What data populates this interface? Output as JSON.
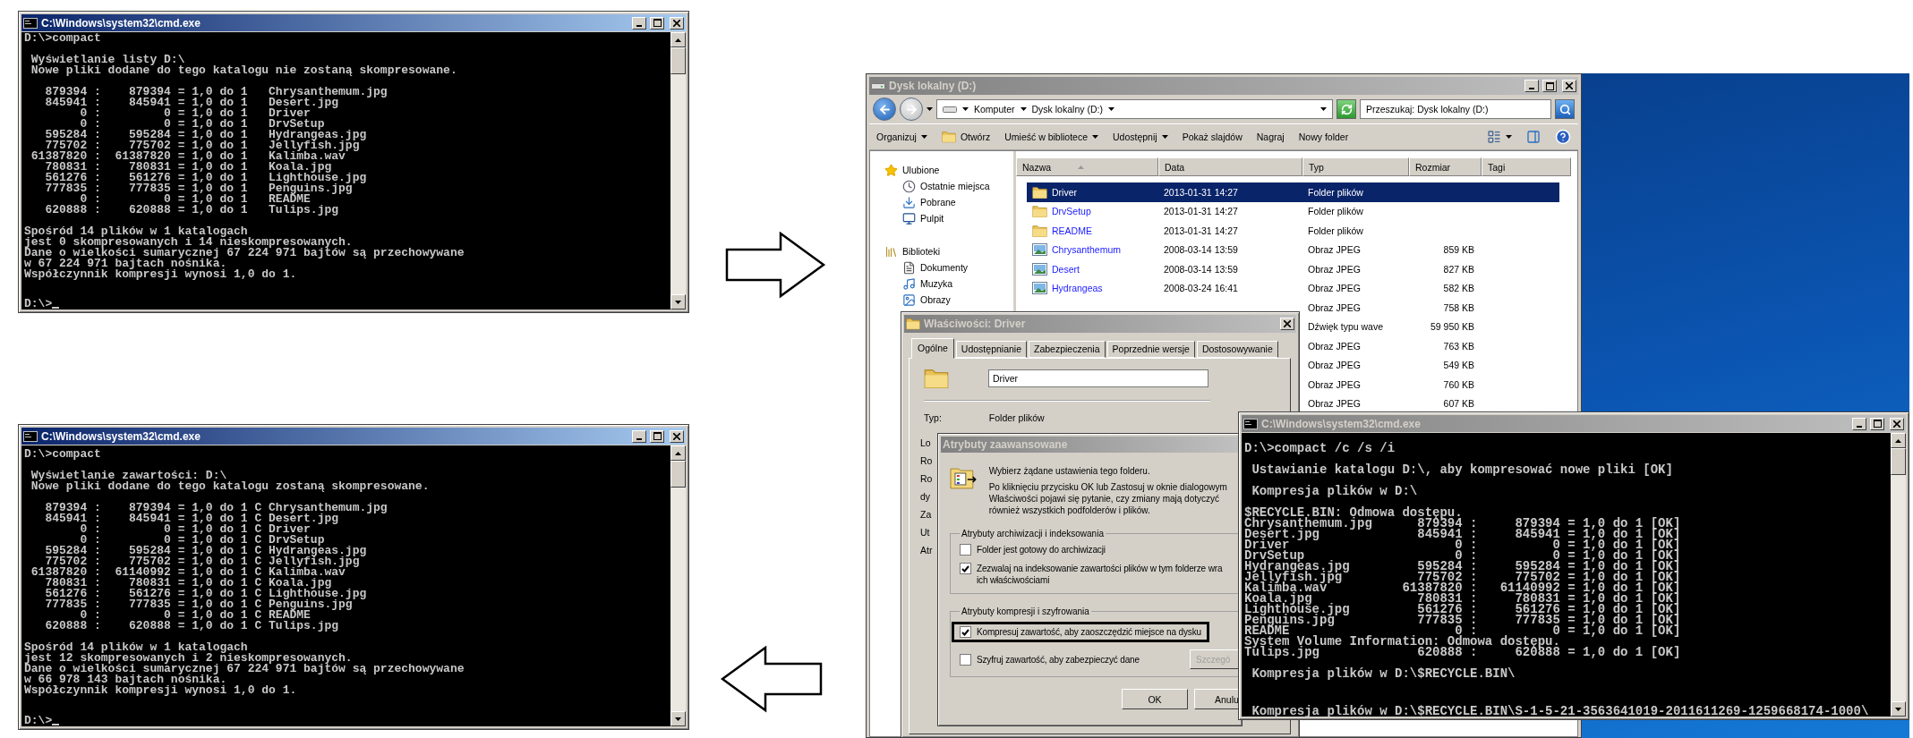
{
  "console_before": {
    "title": "C:\\Windows\\system32\\cmd.exe",
    "active": true,
    "blocks": [
      [
        "D:\\>compact"
      ],
      [
        " Wyświetlanie listy D:\\",
        " Nowe pliki dodane do tego katalogu nie zostaną skompresowane."
      ],
      [
        "   879394 :    879394 = 1,0 do 1   Chrysanthemum.jpg",
        "   845941 :    845941 = 1,0 do 1   Desert.jpg",
        "        0 :         0 = 1,0 do 1   Driver",
        "        0 :         0 = 1,0 do 1   DrvSetup",
        "   595284 :    595284 = 1,0 do 1   Hydrangeas.jpg",
        "   775702 :    775702 = 1,0 do 1   Jellyfish.jpg",
        " 61387820 :  61387820 = 1,0 do 1   Kalimba.wav",
        "   780831 :    780831 = 1,0 do 1   Koala.jpg",
        "   561276 :    561276 = 1,0 do 1   Lighthouse.jpg",
        "   777835 :    777835 = 1,0 do 1   Penguins.jpg",
        "        0 :         0 = 1,0 do 1   README",
        "   620888 :    620888 = 1,0 do 1   Tulips.jpg"
      ],
      [
        "Spośród 14 plików w 1 katalogach",
        "jest 0 skompresowanych i 14 nieskompresowanych.",
        "Dane o wielkości sumarycznej 67 224 971 bajtów są przechowywane",
        "w 67 224 971 bajtach nośnika.",
        "Współczynnik kompresji wynosi 1,0 do 1."
      ]
    ],
    "bottom_line": {
      "text": "D:\\>",
      "cursor": true
    }
  },
  "explorer": {
    "title": "Dysk lokalny (D:)",
    "active": false,
    "breadcrumb": [
      "Komputer",
      "Dysk lokalny (D:)"
    ],
    "search": {
      "placeholder": "Przeszukaj: Dysk lokalny (D:)"
    },
    "toolbar": [
      {
        "label": "Organizuj",
        "kind": "menu"
      },
      {
        "label": "Otwórz",
        "kind": "icon-command"
      },
      {
        "label": "Umieść w bibliotece",
        "kind": "menu"
      },
      {
        "label": "Udostępnij",
        "kind": "menu"
      },
      {
        "label": "Pokaż slajdów",
        "kind": "command"
      },
      {
        "label": "Nagraj",
        "kind": "command"
      },
      {
        "label": "Nowy folder",
        "kind": "command"
      }
    ],
    "nav": [
      {
        "label": "Ulubione",
        "kind": "star",
        "children": [
          {
            "label": "Ostatnie miejsca",
            "kind": "recent"
          },
          {
            "label": "Pobrane",
            "kind": "downloads"
          },
          {
            "label": "Pulpit",
            "kind": "desktop"
          }
        ]
      },
      {
        "label": "Biblioteki",
        "kind": "libraries",
        "children": [
          {
            "label": "Dokumenty",
            "kind": "documents"
          },
          {
            "label": "Muzyka",
            "kind": "music"
          },
          {
            "label": "Obrazy",
            "kind": "pictures"
          }
        ]
      }
    ],
    "columns": [
      {
        "label": "Nazwa",
        "sorted": true
      },
      {
        "label": "Data",
        "sorted": false
      },
      {
        "label": "Typ",
        "sorted": false
      },
      {
        "label": "Rozmiar",
        "sorted": false
      },
      {
        "label": "Tagi",
        "sorted": false
      }
    ],
    "files": [
      {
        "name": "Driver",
        "kind": "folder",
        "date": "2013-01-31 14:27",
        "type": "Folder plików",
        "selected": true
      },
      {
        "name": "DrvSetup",
        "kind": "folder",
        "date": "2013-01-31 14:27",
        "type": "Folder plików",
        "selected": false
      },
      {
        "name": "README",
        "kind": "folder",
        "date": "2013-01-31 14:27",
        "type": "Folder plików",
        "selected": false
      },
      {
        "name": "Chrysanthemum",
        "kind": "image",
        "date": "2008-03-14 13:59",
        "type": "Obraz JPEG",
        "size": "859 KB",
        "selected": false
      },
      {
        "name": "Desert",
        "kind": "image",
        "date": "2008-03-14 13:59",
        "type": "Obraz JPEG",
        "size": "827 KB",
        "selected": false
      },
      {
        "name": "Hydrangeas",
        "kind": "image",
        "date": "2008-03-24 16:41",
        "type": "Obraz JPEG",
        "size": "582 KB",
        "selected": false
      },
      {
        "type": "Obraz JPEG",
        "size": "758 KB",
        "selected": false
      },
      {
        "type": "Dźwięk typu wave",
        "size": "59 950 KB",
        "selected": false
      },
      {
        "type": "Obraz JPEG",
        "size": "763 KB",
        "selected": false
      },
      {
        "type": "Obraz JPEG",
        "size": "549 KB",
        "selected": false
      },
      {
        "type": "Obraz JPEG",
        "size": "760 KB",
        "selected": false
      },
      {
        "type": "Obraz JPEG",
        "size": "607 KB",
        "selected": false
      }
    ]
  },
  "properties_dialog": {
    "title": "Właściwości: Driver",
    "active": false,
    "tabs": [
      {
        "label": "Ogólne",
        "selected": true
      },
      {
        "label": "Udostępnianie",
        "selected": false
      },
      {
        "label": "Zabezpieczenia",
        "selected": false
      },
      {
        "label": "Poprzednie wersje",
        "selected": false
      },
      {
        "label": "Dostosowywanie",
        "selected": false
      }
    ],
    "name_field": {
      "value": "Driver"
    },
    "fields": [
      {
        "label": "Typ:",
        "value": "Folder plików"
      }
    ],
    "cut_labels": [
      "Lo",
      "Ro",
      "Ro",
      "dy",
      "Za",
      "Ut",
      "Atr"
    ]
  },
  "advanced_dialog": {
    "title": "Atrybuty zaawansowane",
    "active": false,
    "heading": "Wybierz żądane ustawienia tego folderu.",
    "description": "Po kliknięciu przycisku OK lub Zastosuj w oknie dialogowym Właściwości pojawi się pytanie, czy zmiany mają dotyczyć również wszystkich podfolderów i plików.",
    "groups": [
      {
        "legend": "Atrybuty archiwizacji i indeksowania",
        "options": [
          {
            "lines": [
              "Folder jest gotowy do archiwizacji"
            ],
            "checked": false,
            "highlighted": false
          },
          {
            "lines": [
              "Zezwalaj na indeksowanie zawartości plików w tym folderze wra",
              "ich właściwościami"
            ],
            "checked": true,
            "highlighted": false
          }
        ]
      },
      {
        "legend": "Atrybuty kompresji i szyfrowania",
        "options": [
          {
            "lines": [
              "Kompresuj zawartość, aby zaoszczędzić miejsce na dysku"
            ],
            "checked": true,
            "highlighted": true
          },
          {
            "lines": [
              "Szyfruj zawartość, aby zabezpieczyć dane"
            ],
            "checked": false,
            "highlighted": false
          }
        ],
        "button": {
          "label": "Szczegó",
          "disabled": true
        }
      }
    ],
    "buttons": [
      {
        "label": "OK"
      },
      {
        "label": "Anulu"
      }
    ]
  },
  "console_compress": {
    "title": "C:\\Windows\\system32\\cmd.exe",
    "active": false,
    "blocks": [
      [
        "D:\\>compact /c /s /i"
      ],
      [
        " Ustawianie katalogu D:\\, aby kompresować nowe pliki [OK]"
      ],
      [
        " Kompresja plików w D:\\"
      ],
      [
        "$RECYCLE.BIN: Odmowa dostępu.",
        "Chrysanthemum.jpg      879394 :     879394 = 1,0 do 1 [OK]",
        "Desert.jpg             845941 :     845941 = 1,0 do 1 [OK]",
        "Driver                      0 :          0 = 1,0 do 1 [OK]",
        "DrvSetup                    0 :          0 = 1,0 do 1 [OK]",
        "Hydrangeas.jpg         595284 :     595284 = 1,0 do 1 [OK]",
        "Jellyfish.jpg          775702 :     775702 = 1,0 do 1 [OK]",
        "Kalimba.wav          61387820 :   61140992 = 1,0 do 1 [OK]",
        "Koala.jpg              780831 :     780831 = 1,0 do 1 [OK]",
        "Lighthouse.jpg         561276 :     561276 = 1,0 do 1 [OK]",
        "Penguins.jpg           777835 :     777835 = 1,0 do 1 [OK]",
        "README                      0 :          0 = 1,0 do 1 [OK]",
        "System Volume Information: Odmowa dostępu.",
        "Tulips.jpg             620888 :     620888 = 1,0 do 1 [OK]"
      ],
      [
        " Kompresja plików w D:\\$RECYCLE.BIN\\"
      ]
    ],
    "bottom_line": {
      "text": " Kompresja plików w D:\\$RECYCLE.BIN\\S-1-5-21-3563641019-2011611269-1259668174-1000\\",
      "cursor": false
    }
  },
  "console_after": {
    "title": "C:\\Windows\\system32\\cmd.exe",
    "active": true,
    "blocks": [
      [
        "D:\\>compact"
      ],
      [
        " Wyświetlanie zawartości: D:\\",
        " Nowe pliki dodane do tego katalogu zostaną skompresowane."
      ],
      [
        "   879394 :    879394 = 1,0 do 1 C Chrysanthemum.jpg",
        "   845941 :    845941 = 1,0 do 1 C Desert.jpg",
        "        0 :         0 = 1,0 do 1 C Driver",
        "        0 :         0 = 1,0 do 1 C DrvSetup",
        "   595284 :    595284 = 1,0 do 1 C Hydrangeas.jpg",
        "   775702 :    775702 = 1,0 do 1 C Jellyfish.jpg",
        " 61387820 :  61140992 = 1,0 do 1 C Kalimba.wav",
        "   780831 :    780831 = 1,0 do 1 C Koala.jpg",
        "   561276 :    561276 = 1,0 do 1 C Lighthouse.jpg",
        "   777835 :    777835 = 1,0 do 1 C Penguins.jpg",
        "        0 :         0 = 1,0 do 1 C README",
        "   620888 :    620888 = 1,0 do 1 C Tulips.jpg"
      ],
      [
        "Spośród 14 plików w 1 katalogach",
        "jest 12 skompresowanych i 2 nieskompresowanych.",
        "Dane o wielkości sumarycznej 67 224 971 bajtów są przechowywane",
        "w 66 978 143 bajtach nośnika.",
        "Współczynnik kompresji wynosi 1,0 do 1."
      ]
    ],
    "bottom_line": {
      "text": "D:\\>",
      "cursor": true
    }
  }
}
